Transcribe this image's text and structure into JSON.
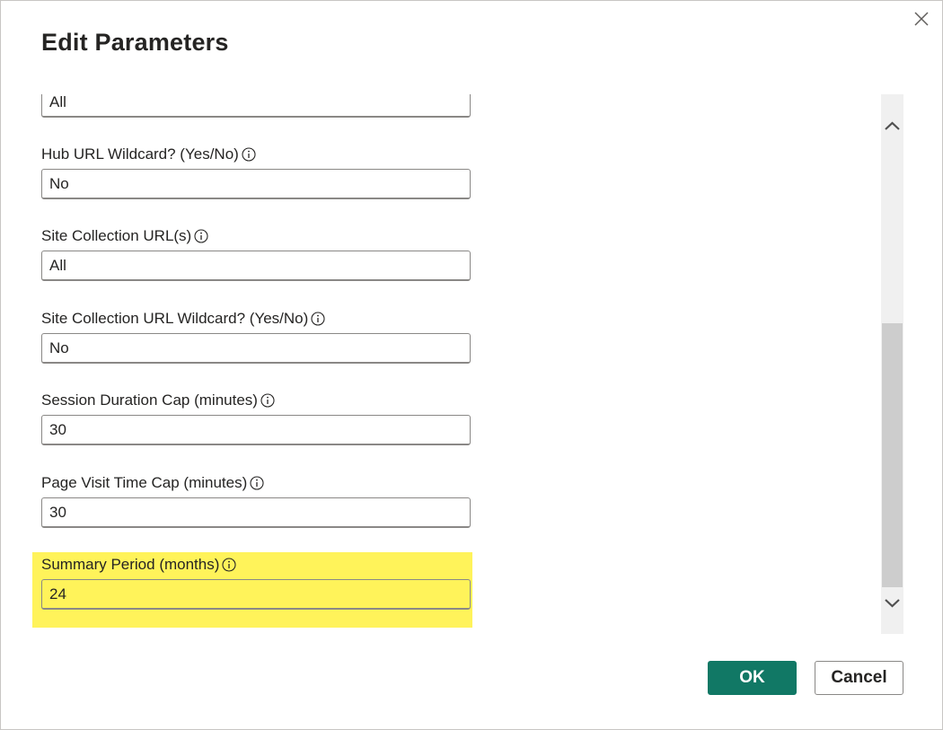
{
  "dialog": {
    "title": "Edit Parameters",
    "close_icon": "close-icon"
  },
  "fields": [
    {
      "label": "",
      "value": "All"
    },
    {
      "label": "Hub URL Wildcard? (Yes/No)",
      "value": "No"
    },
    {
      "label": "Site Collection URL(s)",
      "value": "All"
    },
    {
      "label": "Site Collection URL Wildcard? (Yes/No)",
      "value": "No"
    },
    {
      "label": "Session Duration Cap (minutes)",
      "value": "30"
    },
    {
      "label": "Page Visit Time Cap (minutes)",
      "value": "30"
    },
    {
      "label": "Summary Period (months)",
      "value": "24",
      "highlighted": true
    }
  ],
  "icons": {
    "info": "info-icon",
    "scroll_up": "chevron-up-icon",
    "scroll_down": "chevron-down-icon"
  },
  "buttons": {
    "ok_label": "OK",
    "cancel_label": "Cancel"
  },
  "colors": {
    "primary": "#117865",
    "highlight": "#fff35a",
    "border": "#8a8886",
    "text": "#252423"
  }
}
